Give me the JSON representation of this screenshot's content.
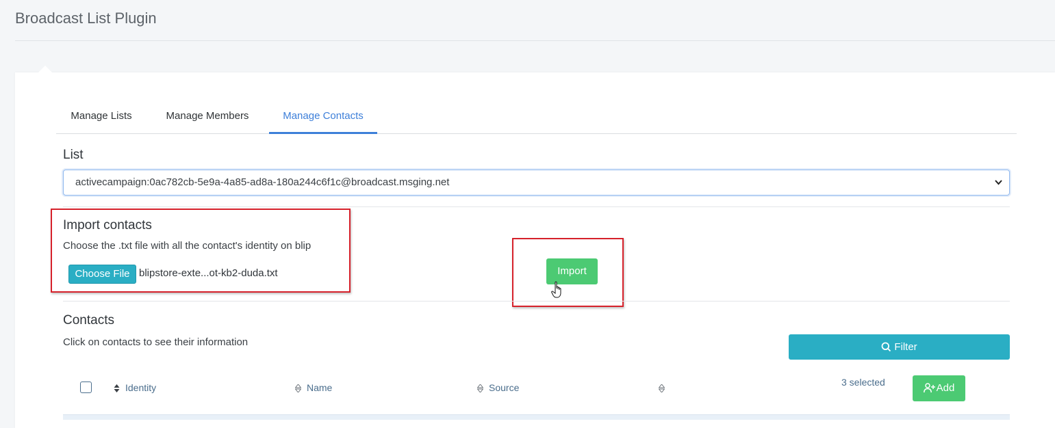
{
  "page": {
    "title": "Broadcast List Plugin"
  },
  "tabs": [
    {
      "label": "Manage Lists"
    },
    {
      "label": "Manage Members"
    },
    {
      "label": "Manage Contacts"
    }
  ],
  "list": {
    "label": "List",
    "selected_value": "activecampaign:0ac782cb-5e9a-4a85-ad8a-180a244c6f1c@broadcast.msging.net"
  },
  "import": {
    "title": "Import contacts",
    "help": "Choose the .txt file with all the contact's identity on blip",
    "choose_file_label": "Choose File",
    "file_name": "blipstore-exte...ot-kb2-duda.txt",
    "import_label": "Import"
  },
  "contacts": {
    "title": "Contacts",
    "help": "Click on contacts to see their information",
    "filter_label": "Filter",
    "columns": [
      "Identity",
      "Name",
      "Source",
      ""
    ],
    "selected_count": "3 selected",
    "add_label": "Add"
  },
  "colors": {
    "accent": "#3d7fd9",
    "teal": "#2aaec4",
    "green": "#4cca73",
    "highlight_red": "#d6202a"
  }
}
